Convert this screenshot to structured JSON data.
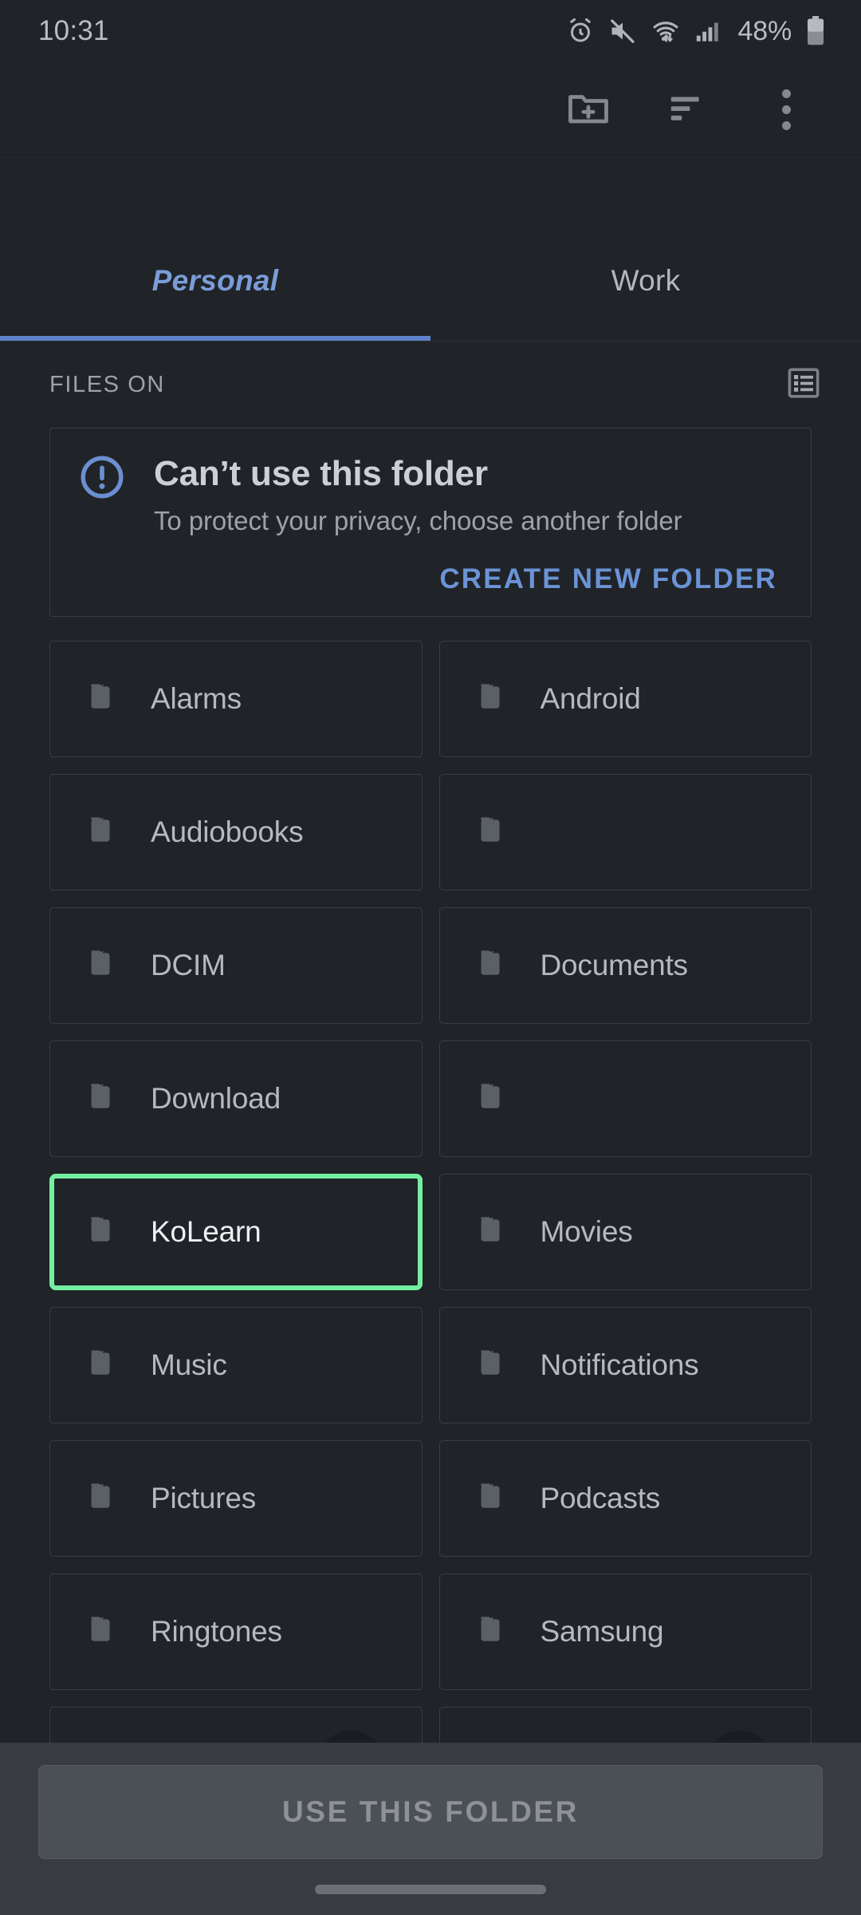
{
  "status_bar": {
    "time": "10:31",
    "battery_percent": "48%",
    "icons": [
      "alarm-icon",
      "mute-icon",
      "wifi-icon",
      "signal-icon",
      "battery-icon"
    ]
  },
  "toolbar": {
    "new_folder_label": "new-folder-icon",
    "sort_label": "sort-icon",
    "overflow_label": "more-options-icon"
  },
  "tabs": [
    {
      "label": "Personal",
      "active": true
    },
    {
      "label": "Work",
      "active": false
    }
  ],
  "section": {
    "title": "FILES ON",
    "view_toggle": "list-view-icon"
  },
  "warning": {
    "icon": "error-circle-icon",
    "title": "Can’t use this folder",
    "subtitle": "To protect your privacy, choose another folder",
    "action_label": "CREATE NEW FOLDER"
  },
  "folders": [
    {
      "name": "Alarms",
      "selected": false
    },
    {
      "name": "Android",
      "selected": false
    },
    {
      "name": "Audiobooks",
      "selected": false
    },
    {
      "name": "",
      "selected": false
    },
    {
      "name": "DCIM",
      "selected": false
    },
    {
      "name": "Documents",
      "selected": false
    },
    {
      "name": "Download",
      "selected": false
    },
    {
      "name": "",
      "selected": false
    },
    {
      "name": "KoLearn",
      "selected": true
    },
    {
      "name": "Movies",
      "selected": false
    },
    {
      "name": "Music",
      "selected": false
    },
    {
      "name": "Notifications",
      "selected": false
    },
    {
      "name": "Pictures",
      "selected": false
    },
    {
      "name": "Podcasts",
      "selected": false
    },
    {
      "name": "Ringtones",
      "selected": false
    },
    {
      "name": "Samsung",
      "selected": false
    }
  ],
  "peek_row": [
    {
      "badge": "expand-icon"
    },
    {
      "badge": "expand-icon"
    }
  ],
  "bottom_bar": {
    "primary_label": "USE THIS FOLDER",
    "primary_enabled": false
  },
  "colors": {
    "background": "#202328",
    "accent_blue": "#6b93d6",
    "tab_active": "#7a9dd8",
    "selection_green": "#74efa2",
    "card_border": "#3a3e44",
    "bottom_bar": "#383c41"
  }
}
